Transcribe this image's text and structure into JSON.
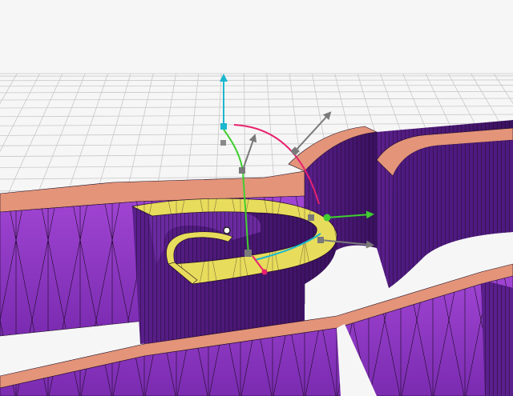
{
  "viewport": {
    "view": "3d-perspective",
    "background_color": "#f6f6f6",
    "grid_color": "#c8c8c8"
  },
  "mesh": {
    "wireframe": true,
    "wall_color": "#9a3fc9",
    "wall_dark_color": "#4a1b73",
    "top_color": "#e39479",
    "selected_face_color": "#e8dc5c",
    "edge_color": "#1a0a22"
  },
  "gizmo": {
    "axis_y_color": "#1bb7cf",
    "axis_x_color": "#3fce2f",
    "rotate_ring_color": "#e8216e",
    "rotate_ring_2_color": "#1bb7cf",
    "handle_color": "#8a8a8a",
    "icons": [
      "move-y-arrow",
      "move-x-arrow",
      "rotate-ring",
      "scale-handle",
      "pivot-point"
    ]
  }
}
